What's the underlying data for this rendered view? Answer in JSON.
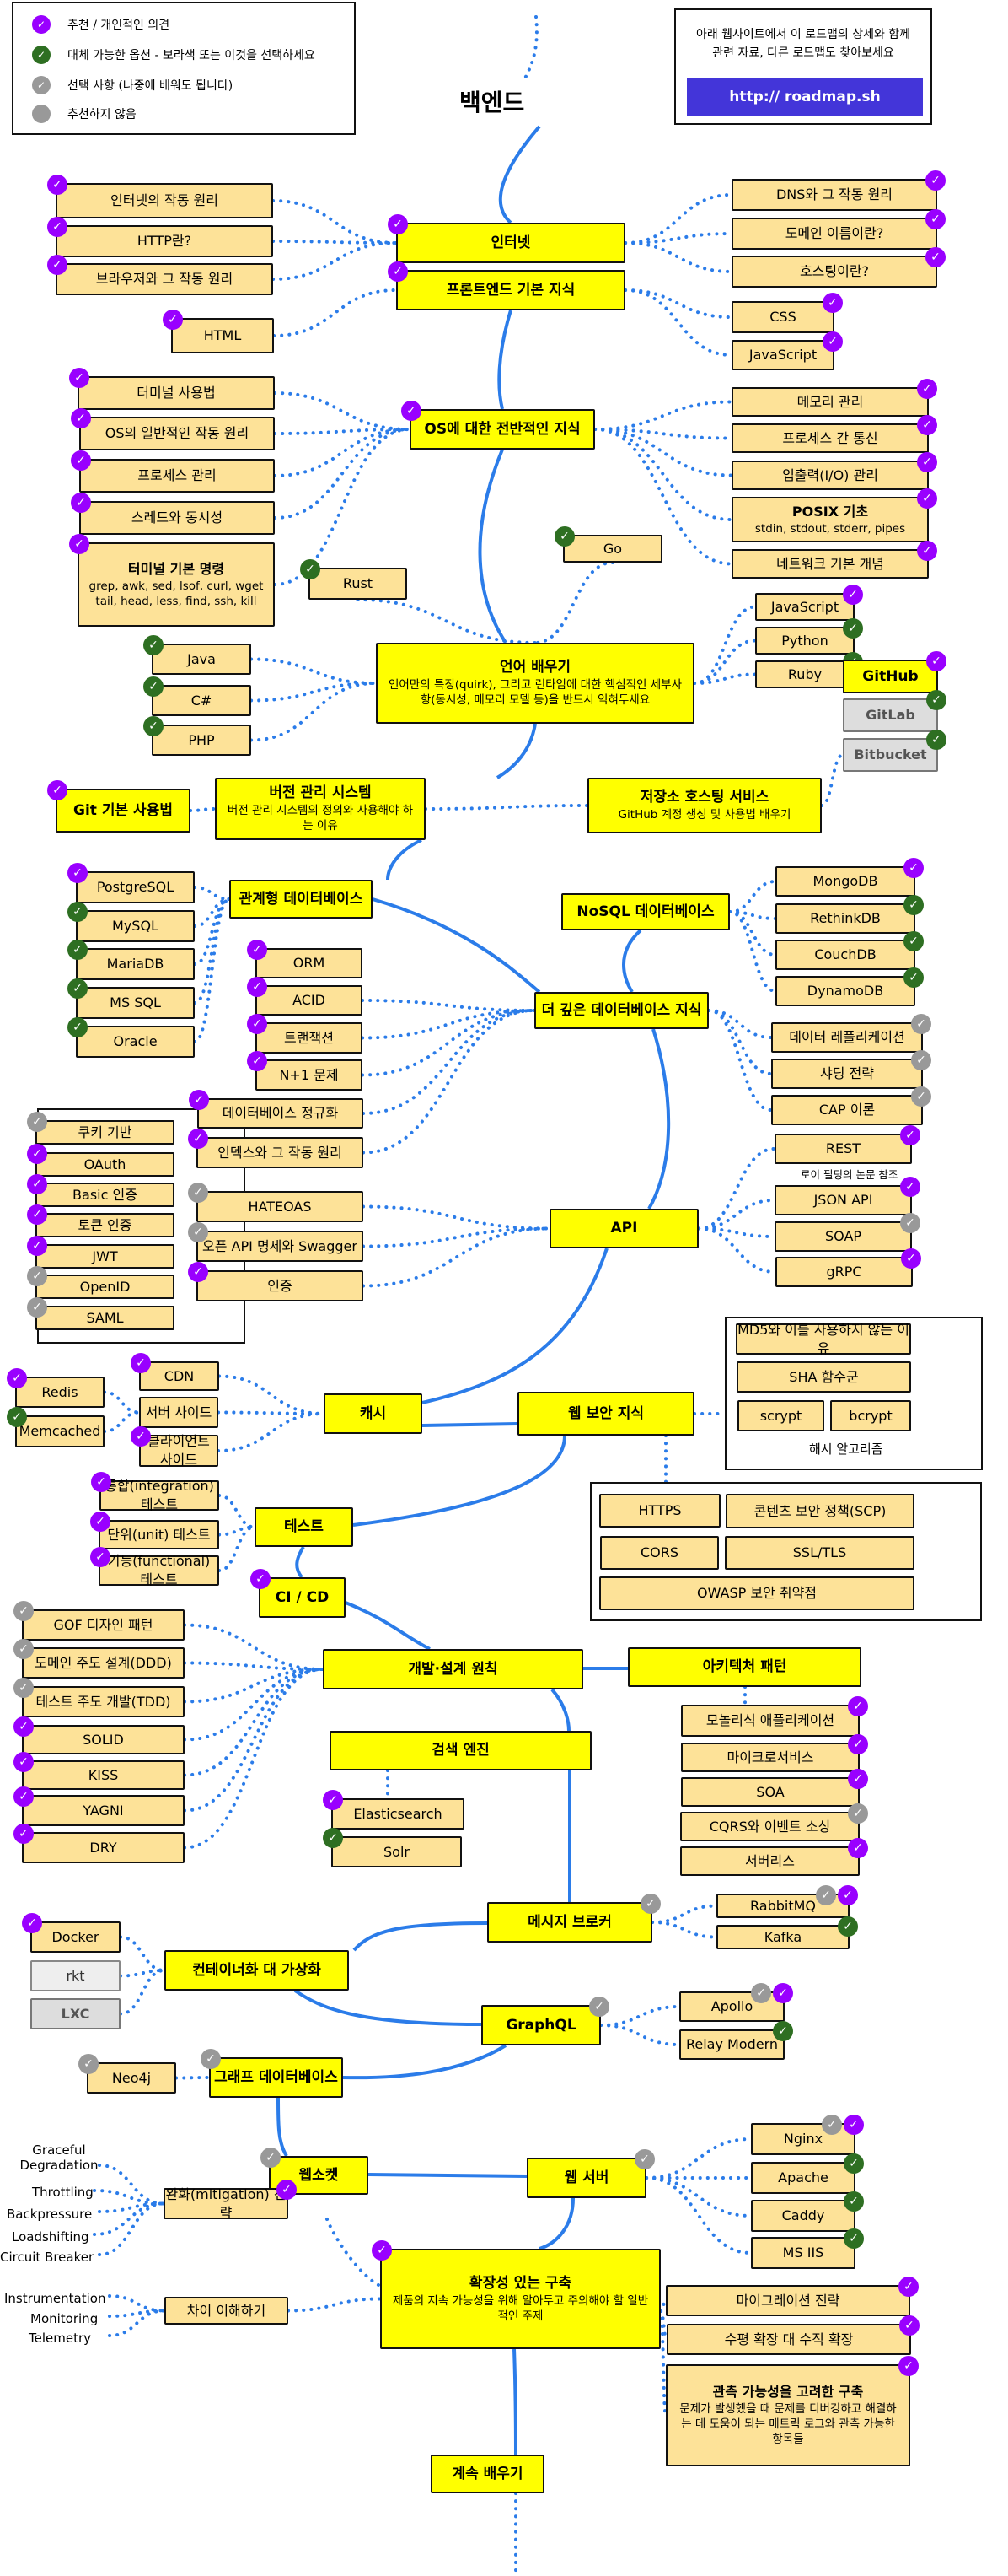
{
  "title": "백엔드",
  "legend": [
    {
      "color": "#9900ff",
      "icon": "check-icon",
      "label": "추천 / 개인적인 의견"
    },
    {
      "color": "#2e6f22",
      "icon": "check-icon",
      "label": "대체 가능한 옵션 - 보라색 또는 이것을 선택하세요"
    },
    {
      "color": "#999999",
      "icon": "check-icon",
      "label": "선택 사항 (나중에 배워도 됩니다)"
    },
    {
      "color": "#999999",
      "icon": "dot-icon",
      "label": "추천하지 않음"
    }
  ],
  "info": {
    "message_line1": "아래 웹사이트에서 이 로드맵의 상세와 함께",
    "message_line2": "관련 자료, 다른 로드맵도 찾아보세요",
    "link_label": "http:// roadmap.sh"
  },
  "colors": {
    "main": "#ffff00",
    "sub": "#fde298",
    "line": "#2b7ce9",
    "brand": "#4335d9",
    "recommended": "#9900ff",
    "alternative": "#2e6f22",
    "optional": "#999999"
  },
  "nodes": [
    {
      "id": "internet",
      "label": "인터넷",
      "type": "main",
      "badges": [
        "purple"
      ]
    },
    {
      "id": "how-internet",
      "label": "인터넷의 작동 원리",
      "type": "sub",
      "badges": [
        "purple"
      ]
    },
    {
      "id": "http",
      "label": "HTTP란?",
      "type": "sub",
      "badges": [
        "purple"
      ]
    },
    {
      "id": "browsers",
      "label": "브라우저와 그 작동 원리",
      "type": "sub",
      "badges": [
        "purple"
      ]
    },
    {
      "id": "dns",
      "label": "DNS와 그 작동 원리",
      "type": "sub",
      "badges": [
        "purple"
      ]
    },
    {
      "id": "domain",
      "label": "도메인 이름이란?",
      "type": "sub",
      "badges": [
        "purple"
      ]
    },
    {
      "id": "hosting",
      "label": "호스팅이란?",
      "type": "sub",
      "badges": [
        "purple"
      ]
    },
    {
      "id": "frontend",
      "label": "프론트엔드 기본 지식",
      "type": "main",
      "badges": [
        "purple"
      ]
    },
    {
      "id": "html",
      "label": "HTML",
      "type": "sub",
      "badges": [
        "purple"
      ]
    },
    {
      "id": "css",
      "label": "CSS",
      "type": "sub",
      "badges": [
        "purple"
      ]
    },
    {
      "id": "js1",
      "label": "JavaScript",
      "type": "sub",
      "badges": [
        "purple"
      ]
    },
    {
      "id": "os",
      "label": "OS에 대한 전반적인 지식",
      "type": "main",
      "badges": [
        "purple"
      ]
    },
    {
      "id": "terminal",
      "label": "터미널 사용법",
      "type": "sub",
      "badges": [
        "purple"
      ]
    },
    {
      "id": "os-how",
      "label": "OS의 일반적인 작동 원리",
      "type": "sub",
      "badges": [
        "purple"
      ]
    },
    {
      "id": "proc",
      "label": "프로세스 관리",
      "type": "sub",
      "badges": [
        "purple"
      ]
    },
    {
      "id": "threads",
      "label": "스레드와 동시성",
      "type": "sub",
      "badges": [
        "purple"
      ]
    },
    {
      "id": "term-cmds",
      "label": "터미널 기본 명령",
      "desc": "grep, awk, sed, lsof, curl, wget tail, head, less, find, ssh, kill",
      "type": "sub",
      "badges": [
        "purple"
      ]
    },
    {
      "id": "memory",
      "label": "메모리 관리",
      "type": "sub",
      "badges": [
        "purple"
      ]
    },
    {
      "id": "ipc",
      "label": "프로세스 간 통신",
      "type": "sub",
      "badges": [
        "purple"
      ]
    },
    {
      "id": "io",
      "label": "입출력(I/O) 관리",
      "type": "sub",
      "badges": [
        "purple"
      ]
    },
    {
      "id": "posix",
      "label": "POSIX 기초",
      "desc": "stdin, stdout, stderr, pipes",
      "type": "sub",
      "badges": [
        "purple"
      ]
    },
    {
      "id": "network",
      "label": "네트워크 기본 개념",
      "type": "sub",
      "badges": [
        "purple"
      ]
    },
    {
      "id": "rust",
      "label": "Rust",
      "type": "sub",
      "badges": [
        "green"
      ]
    },
    {
      "id": "go",
      "label": "Go",
      "type": "sub",
      "badges": [
        "green"
      ]
    },
    {
      "id": "lang",
      "label": "언어 배우기",
      "desc": "언어만의 특징(quirk), 그리고 런타임에 대한 핵심적인 세부사항(동시성, 메모리 모델 등)을 반드시 익혀두세요",
      "type": "main",
      "badges": []
    },
    {
      "id": "java",
      "label": "Java",
      "type": "sub",
      "badges": [
        "green"
      ]
    },
    {
      "id": "csharp",
      "label": "C#",
      "type": "sub",
      "badges": [
        "green"
      ]
    },
    {
      "id": "php",
      "label": "PHP",
      "type": "sub",
      "badges": [
        "green"
      ]
    },
    {
      "id": "js2",
      "label": "JavaScript",
      "type": "sub",
      "badges": [
        "purple"
      ]
    },
    {
      "id": "python",
      "label": "Python",
      "type": "sub",
      "badges": [
        "green"
      ]
    },
    {
      "id": "ruby",
      "label": "Ruby",
      "type": "sub",
      "badges": [
        "green"
      ]
    },
    {
      "id": "github",
      "label": "GitHub",
      "type": "main",
      "badges": [
        "purple"
      ]
    },
    {
      "id": "gitlab",
      "label": "GitLab",
      "type": "opt",
      "badges": [
        "green"
      ]
    },
    {
      "id": "bitbucket",
      "label": "Bitbucket",
      "type": "opt",
      "badges": [
        "green"
      ]
    },
    {
      "id": "git",
      "label": "Git 기본 사용법",
      "type": "main",
      "badges": [
        "purple"
      ]
    },
    {
      "id": "vcs",
      "label": "버전 관리 시스템",
      "desc": "버전 관리 시스템의 정의와 사용해야 하는 이유",
      "type": "main",
      "badges": []
    },
    {
      "id": "repo",
      "label": "저장소 호스팅 서비스",
      "desc": "GitHub 계정 생성 및 사용법 배우기",
      "type": "main",
      "badges": []
    },
    {
      "id": "rdb",
      "label": "관계형 데이터베이스",
      "type": "main",
      "badges": []
    },
    {
      "id": "postgres",
      "label": "PostgreSQL",
      "type": "sub",
      "badges": [
        "purple"
      ]
    },
    {
      "id": "mysql",
      "label": "MySQL",
      "type": "sub",
      "badges": [
        "green"
      ]
    },
    {
      "id": "mariadb",
      "label": "MariaDB",
      "type": "sub",
      "badges": [
        "green"
      ]
    },
    {
      "id": "mssql",
      "label": "MS SQL",
      "type": "sub",
      "badges": [
        "green"
      ]
    },
    {
      "id": "oracle",
      "label": "Oracle",
      "type": "sub",
      "badges": [
        "green"
      ]
    },
    {
      "id": "nosql",
      "label": "NoSQL 데이터베이스",
      "type": "main",
      "badges": []
    },
    {
      "id": "mongo",
      "label": "MongoDB",
      "type": "sub",
      "badges": [
        "purple"
      ]
    },
    {
      "id": "rethink",
      "label": "RethinkDB",
      "type": "sub",
      "badges": [
        "green"
      ]
    },
    {
      "id": "couch",
      "label": "CouchDB",
      "type": "sub",
      "badges": [
        "green"
      ]
    },
    {
      "id": "dynamo",
      "label": "DynamoDB",
      "type": "sub",
      "badges": [
        "green"
      ]
    },
    {
      "id": "orm",
      "label": "ORM",
      "type": "sub",
      "badges": [
        "purple"
      ]
    },
    {
      "id": "acid",
      "label": "ACID",
      "type": "sub",
      "badges": [
        "purple"
      ]
    },
    {
      "id": "tx",
      "label": "트랜잭션",
      "type": "sub",
      "badges": [
        "purple"
      ]
    },
    {
      "id": "n1",
      "label": "N+1 문제",
      "type": "sub",
      "badges": [
        "purple"
      ]
    },
    {
      "id": "norm",
      "label": "데이터베이스 정규화",
      "type": "sub",
      "badges": [
        "purple"
      ]
    },
    {
      "id": "index",
      "label": "인덱스와 그 작동 원리",
      "type": "sub",
      "badges": [
        "purple"
      ]
    },
    {
      "id": "moredb",
      "label": "더 깊은 데이터베이스 지식",
      "type": "main",
      "badges": []
    },
    {
      "id": "replication",
      "label": "데이터 레플리케이션",
      "type": "sub",
      "badges": [
        "gray"
      ]
    },
    {
      "id": "sharding",
      "label": "샤딩 전략",
      "type": "sub",
      "badges": [
        "gray"
      ]
    },
    {
      "id": "cap",
      "label": "CAP 이론",
      "type": "sub",
      "badges": [
        "gray"
      ]
    },
    {
      "id": "cookie",
      "label": "쿠키 기반",
      "type": "sub",
      "badges": [
        "gray"
      ]
    },
    {
      "id": "oauth",
      "label": "OAuth",
      "type": "sub",
      "badges": [
        "purple"
      ]
    },
    {
      "id": "basic",
      "label": "Basic 인증",
      "type": "sub",
      "badges": [
        "purple"
      ]
    },
    {
      "id": "token",
      "label": "토큰 인증",
      "type": "sub",
      "badges": [
        "purple"
      ]
    },
    {
      "id": "jwt",
      "label": "JWT",
      "type": "sub",
      "badges": [
        "purple"
      ]
    },
    {
      "id": "openid",
      "label": "OpenID",
      "type": "sub",
      "badges": [
        "gray"
      ]
    },
    {
      "id": "saml",
      "label": "SAML",
      "type": "sub",
      "badges": [
        "gray"
      ]
    },
    {
      "id": "hateoas",
      "label": "HATEOAS",
      "type": "sub",
      "badges": [
        "gray"
      ]
    },
    {
      "id": "openapi",
      "label": "오픈 API 명세와 Swagger",
      "type": "sub",
      "badges": [
        "gray"
      ]
    },
    {
      "id": "auth",
      "label": "인증",
      "type": "sub",
      "badges": [
        "purple"
      ]
    },
    {
      "id": "api",
      "label": "API",
      "type": "main",
      "badges": []
    },
    {
      "id": "rest",
      "label": "REST",
      "type": "sub",
      "badges": [
        "purple"
      ]
    },
    {
      "id": "jsonapi",
      "label": "JSON API",
      "type": "sub",
      "badges": [
        "purple"
      ]
    },
    {
      "id": "soap",
      "label": "SOAP",
      "type": "sub",
      "badges": [
        "gray"
      ]
    },
    {
      "id": "grpc",
      "label": "gRPC",
      "type": "sub",
      "badges": [
        "purple"
      ]
    },
    {
      "id": "redis",
      "label": "Redis",
      "type": "sub",
      "badges": [
        "purple"
      ]
    },
    {
      "id": "memcached",
      "label": "Memcached",
      "type": "sub",
      "badges": [
        "green"
      ]
    },
    {
      "id": "cdn",
      "label": "CDN",
      "type": "sub",
      "badges": [
        "purple"
      ]
    },
    {
      "id": "server-side",
      "label": "서버 사이드",
      "type": "sub",
      "badges": []
    },
    {
      "id": "client-side",
      "label": "클라이언트 사이드",
      "type": "sub",
      "badges": [
        "purple"
      ]
    },
    {
      "id": "cache",
      "label": "캐시",
      "type": "main",
      "badges": []
    },
    {
      "id": "websec",
      "label": "웹 보안 지식",
      "type": "main",
      "badges": []
    },
    {
      "id": "md5",
      "label": "MD5와 이를 사용하지 않는 이유",
      "type": "sub",
      "badges": []
    },
    {
      "id": "sha",
      "label": "SHA 함수군",
      "type": "sub",
      "badges": []
    },
    {
      "id": "scrypt",
      "label": "scrypt",
      "type": "sub",
      "badges": []
    },
    {
      "id": "bcrypt",
      "label": "bcrypt",
      "type": "sub",
      "badges": []
    },
    {
      "id": "https",
      "label": "HTTPS",
      "type": "sub",
      "badges": []
    },
    {
      "id": "csp",
      "label": "콘텐츠 보안 정책(SCP)",
      "type": "sub",
      "badges": []
    },
    {
      "id": "cors",
      "label": "CORS",
      "type": "sub",
      "badges": []
    },
    {
      "id": "ssl",
      "label": "SSL/TLS",
      "type": "sub",
      "badges": []
    },
    {
      "id": "owasp",
      "label": "OWASP 보안 취약점",
      "type": "sub",
      "badges": []
    },
    {
      "id": "integ",
      "label": "통합(integration) 테스트",
      "type": "sub",
      "badges": [
        "purple"
      ]
    },
    {
      "id": "unit",
      "label": "단위(unit) 테스트",
      "type": "sub",
      "badges": [
        "purple"
      ]
    },
    {
      "id": "func",
      "label": "기능(functional) 테스트",
      "type": "sub",
      "badges": [
        "purple"
      ]
    },
    {
      "id": "testing",
      "label": "테스트",
      "type": "main",
      "badges": []
    },
    {
      "id": "cicd",
      "label": "CI / CD",
      "type": "main",
      "badges": [
        "purple"
      ]
    },
    {
      "id": "gof",
      "label": "GOF 디자인 패턴",
      "type": "sub",
      "badges": [
        "gray"
      ]
    },
    {
      "id": "ddd",
      "label": "도메인 주도 설계(DDD)",
      "type": "sub",
      "badges": [
        "gray"
      ]
    },
    {
      "id": "tdd",
      "label": "테스트 주도 개발(TDD)",
      "type": "sub",
      "badges": [
        "gray"
      ]
    },
    {
      "id": "solid",
      "label": "SOLID",
      "type": "sub",
      "badges": [
        "purple"
      ]
    },
    {
      "id": "kiss",
      "label": "KISS",
      "type": "sub",
      "badges": [
        "purple"
      ]
    },
    {
      "id": "yagni",
      "label": "YAGNI",
      "type": "sub",
      "badges": [
        "purple"
      ]
    },
    {
      "id": "dry",
      "label": "DRY",
      "type": "sub",
      "badges": [
        "purple"
      ]
    },
    {
      "id": "design",
      "label": "개발·설계 원칙",
      "type": "main",
      "badges": []
    },
    {
      "id": "arch",
      "label": "아키텍처 패턴",
      "type": "main",
      "badges": []
    },
    {
      "id": "monolith",
      "label": "모놀리식 애플리케이션",
      "type": "sub",
      "badges": [
        "purple"
      ]
    },
    {
      "id": "micro",
      "label": "마이크로서비스",
      "type": "sub",
      "badges": [
        "purple"
      ]
    },
    {
      "id": "soa",
      "label": "SOA",
      "type": "sub",
      "badges": [
        "purple"
      ]
    },
    {
      "id": "cqrs",
      "label": "CQRS와 이벤트 소싱",
      "type": "sub",
      "badges": [
        "gray"
      ]
    },
    {
      "id": "serverless",
      "label": "서버리스",
      "type": "sub",
      "badges": [
        "purple"
      ]
    },
    {
      "id": "search",
      "label": "검색 엔진",
      "type": "main",
      "badges": []
    },
    {
      "id": "elastic",
      "label": "Elasticsearch",
      "type": "sub",
      "badges": [
        "purple"
      ]
    },
    {
      "id": "solr",
      "label": "Solr",
      "type": "sub",
      "badges": [
        "green"
      ]
    },
    {
      "id": "mq",
      "label": "메시지 브로커",
      "type": "main",
      "badges": [
        "gray"
      ]
    },
    {
      "id": "rabbit",
      "label": "RabbitMQ",
      "type": "sub",
      "badges": [
        "gray",
        "purple"
      ]
    },
    {
      "id": "kafka",
      "label": "Kafka",
      "type": "sub",
      "badges": [
        "green"
      ]
    },
    {
      "id": "docker",
      "label": "Docker",
      "type": "sub",
      "badges": [
        "purple"
      ]
    },
    {
      "id": "rkt",
      "label": "rkt",
      "type": "opt-light",
      "badges": []
    },
    {
      "id": "lxc",
      "label": "LXC",
      "type": "opt",
      "badges": []
    },
    {
      "id": "containers",
      "label": "컨테이너화 대 가상화",
      "type": "main",
      "badges": []
    },
    {
      "id": "graphql",
      "label": "GraphQL",
      "type": "main",
      "badges": [
        "gray"
      ]
    },
    {
      "id": "apollo",
      "label": "Apollo",
      "type": "sub",
      "badges": [
        "gray",
        "purple"
      ]
    },
    {
      "id": "relay",
      "label": "Relay Modern",
      "type": "sub",
      "badges": [
        "green"
      ]
    },
    {
      "id": "neo4j",
      "label": "Neo4j",
      "type": "sub",
      "badges": [
        "gray"
      ]
    },
    {
      "id": "graphdb",
      "label": "그래프 데이터베이스",
      "type": "main",
      "badges": [
        "gray"
      ]
    },
    {
      "id": "websocket",
      "label": "웹소켓",
      "type": "main",
      "badges": [
        "gray"
      ]
    },
    {
      "id": "webserver",
      "label": "웹 서버",
      "type": "main",
      "badges": [
        "gray"
      ]
    },
    {
      "id": "nginx",
      "label": "Nginx",
      "type": "sub",
      "badges": [
        "gray",
        "purple"
      ]
    },
    {
      "id": "apache",
      "label": "Apache",
      "type": "sub",
      "badges": [
        "green"
      ]
    },
    {
      "id": "caddy",
      "label": "Caddy",
      "type": "sub",
      "badges": [
        "green"
      ]
    },
    {
      "id": "iis",
      "label": "MS IIS",
      "type": "sub",
      "badges": [
        "green"
      ]
    },
    {
      "id": "mitigation",
      "label": "완화(mitigation) 전략",
      "type": "sub",
      "badges": [
        "purple"
      ]
    },
    {
      "id": "diff",
      "label": "차이 이해하기",
      "type": "sub",
      "badges": []
    },
    {
      "id": "scalable",
      "label": "확장성 있는 구축",
      "desc": "제품의 지속 가능성을 위해 알아두고 주의해야 할 일반적인 주제",
      "type": "main",
      "badges": [
        "purple"
      ]
    },
    {
      "id": "migration",
      "label": "마이그레이션 전략",
      "type": "sub",
      "badges": [
        "purple"
      ]
    },
    {
      "id": "scaling",
      "label": "수평 확장 대 수직 확장",
      "type": "sub",
      "badges": [
        "purple"
      ]
    },
    {
      "id": "observability",
      "label": "관측 가능성을 고려한 구축",
      "desc": "문제가 발생했을 때 문제를 디버깅하고 해결하는 데 도움이 되는 메트릭 로그와 관측 가능한 항목들",
      "type": "sub",
      "badges": [
        "purple"
      ]
    },
    {
      "id": "keep",
      "label": "계속 배우기",
      "type": "main",
      "badges": []
    }
  ],
  "frames": {
    "hashing_caption": "해시 알고리즘",
    "rest_note": "로이 필딩의 논문 참조"
  },
  "plain_labels": [
    {
      "id": "graceful",
      "label": "Graceful Degradation"
    },
    {
      "id": "throttling",
      "label": "Throttling"
    },
    {
      "id": "backpressure",
      "label": "Backpressure"
    },
    {
      "id": "loadshifting",
      "label": "Loadshifting"
    },
    {
      "id": "circuit",
      "label": "Circuit Breaker"
    },
    {
      "id": "instrumentation",
      "label": "Instrumentation"
    },
    {
      "id": "monitoring",
      "label": "Monitoring"
    },
    {
      "id": "telemetry",
      "label": "Telemetry"
    }
  ]
}
